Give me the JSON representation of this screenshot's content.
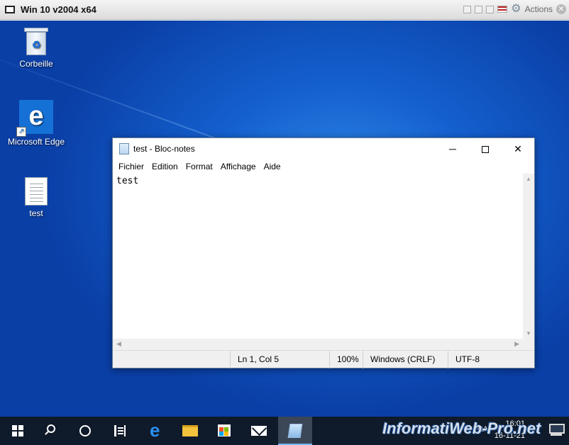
{
  "vm_bar": {
    "title": "Win 10 v2004 x64",
    "actions_label": "Actions"
  },
  "desktop": {
    "icons": [
      {
        "label": "Corbeille"
      },
      {
        "label": "Microsoft Edge"
      },
      {
        "label": "test"
      }
    ]
  },
  "notepad": {
    "title": "test - Bloc-notes",
    "menu": [
      "Fichier",
      "Edition",
      "Format",
      "Affichage",
      "Aide"
    ],
    "content": "test",
    "status": {
      "position": "Ln 1, Col 5",
      "zoom": "100%",
      "line_ending": "Windows (CRLF)",
      "encoding": "UTF-8"
    }
  },
  "taskbar": {
    "language": "FRA",
    "time": "16:01",
    "date": "16-11-21"
  },
  "watermark": "InformatiWeb-Pro.net",
  "colors": {
    "desktop_blue": "#1460cf",
    "taskbar": "#0f1a2a"
  }
}
